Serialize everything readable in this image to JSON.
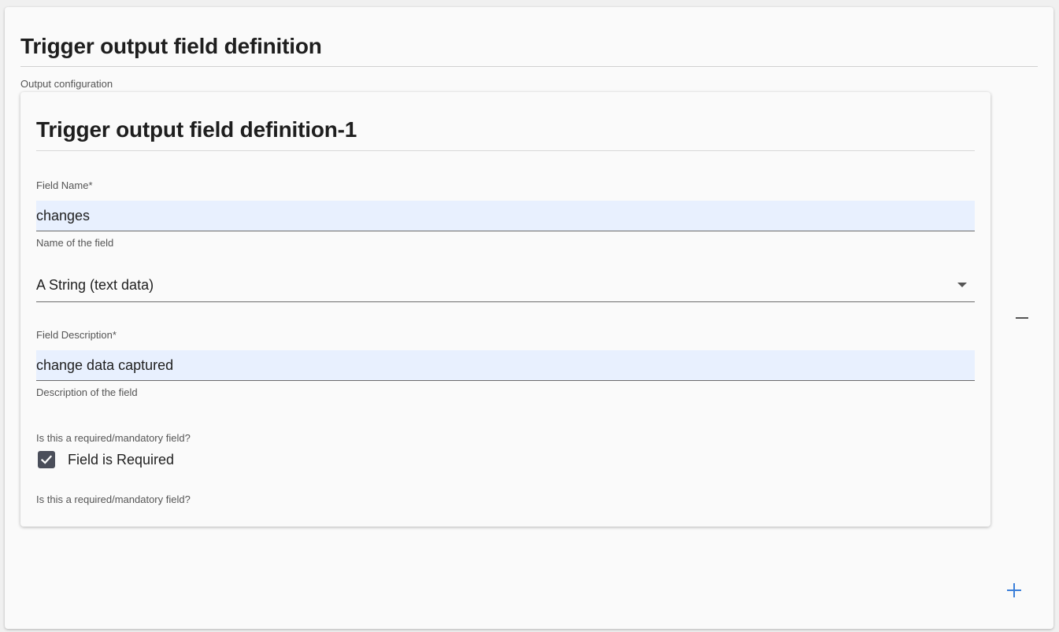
{
  "page": {
    "title": "Trigger output field definition",
    "section_label": "Output configuration"
  },
  "card": {
    "title": "Trigger output field definition-1",
    "field_name": {
      "label": "Field Name",
      "required_mark": "*",
      "value": "changes",
      "helper": "Name of the field"
    },
    "field_type": {
      "value": "A String (text data)"
    },
    "field_description": {
      "label": "Field Description",
      "required_mark": "*",
      "value": "change data captured",
      "helper": "Description of the field"
    },
    "required": {
      "question": "Is this a required/mandatory field?",
      "label": "Field is Required",
      "checked": true,
      "helper": "Is this a required/mandatory field?"
    }
  },
  "icons": {
    "remove": "minus-icon",
    "add": "plus-icon",
    "dropdown": "chevron-down-icon",
    "check": "check-icon"
  },
  "colors": {
    "input_background": "#e8f0fe",
    "checkbox": "#4a4e5a",
    "accent": "#3b7fd9"
  }
}
